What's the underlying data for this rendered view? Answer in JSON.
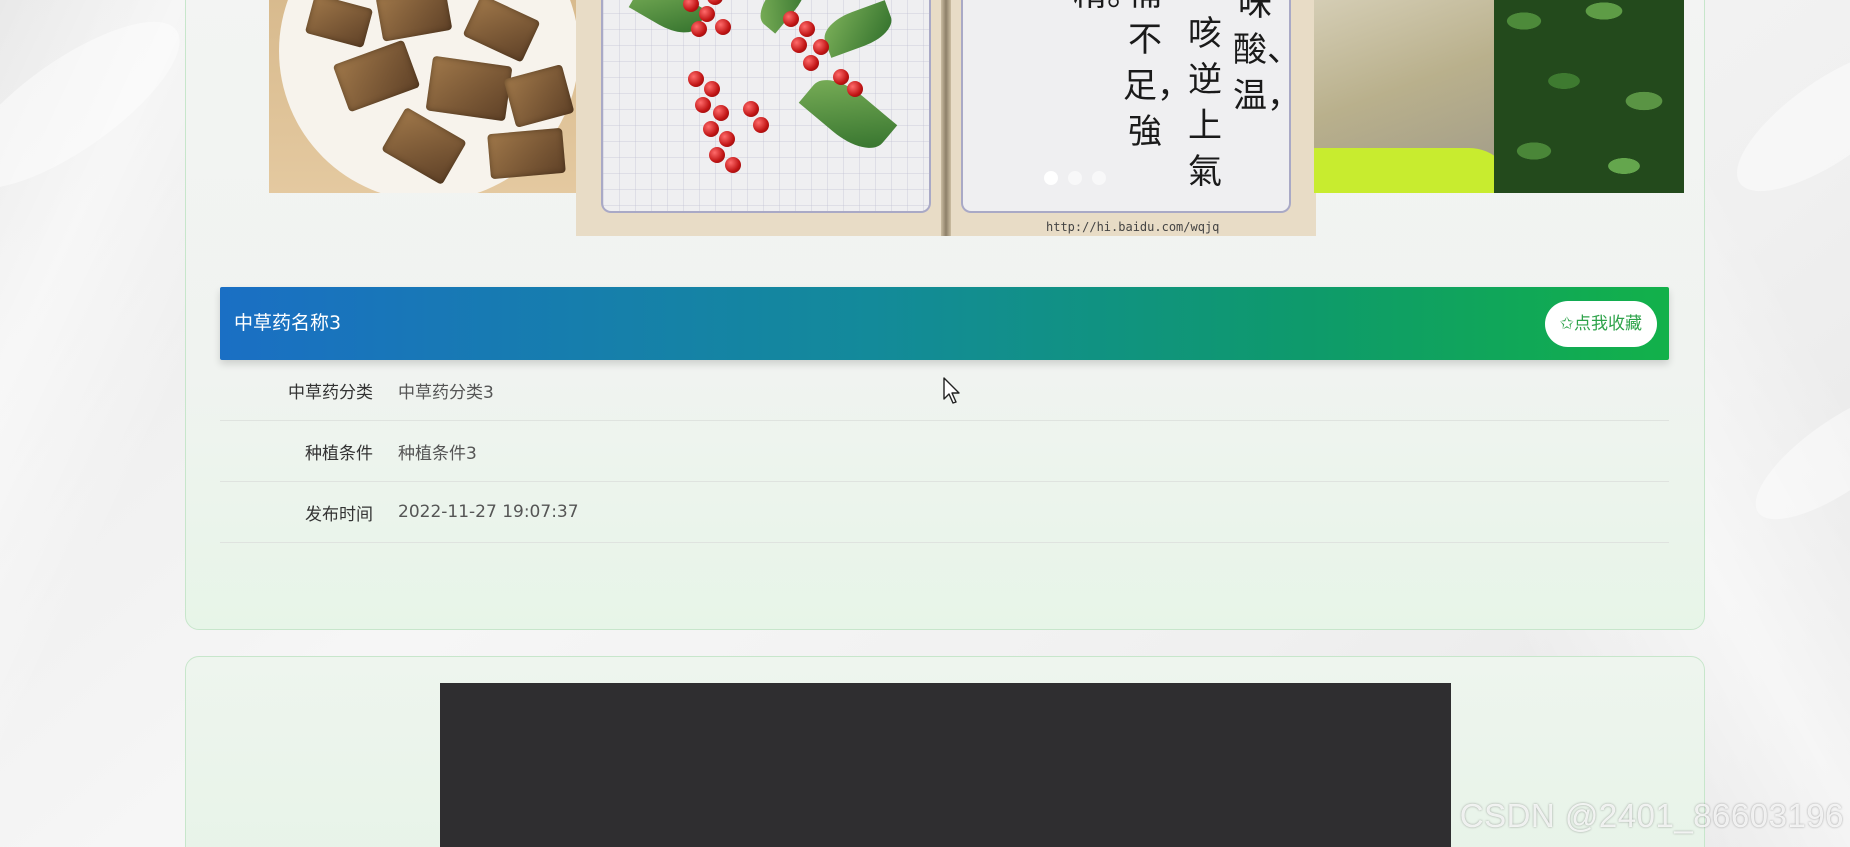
{
  "herb": {
    "name": "中草药名称3",
    "favorite_label": "✩点我收藏",
    "fields": [
      {
        "label": "中草药分类",
        "value": "中草药分类3"
      },
      {
        "label": "种植条件",
        "value": "种植条件3"
      },
      {
        "label": "发布时间",
        "value": "2022-11-27 19:07:37"
      }
    ]
  },
  "carousel": {
    "active_index": 0,
    "dot_count": 3,
    "book_poem": [
      "味酸、温，",
      "咳逆上氣",
      "補不足，強",
      "精。"
    ],
    "book_url": "http://hi.baidu.com/wqjq"
  },
  "watermark": "CSDN @2401_86603196",
  "colors": {
    "title_gradient_start": "#1a6fc4",
    "title_gradient_end": "#12b14a",
    "accent_green": "#2ea34a",
    "card_border": "#c7e6cb"
  }
}
